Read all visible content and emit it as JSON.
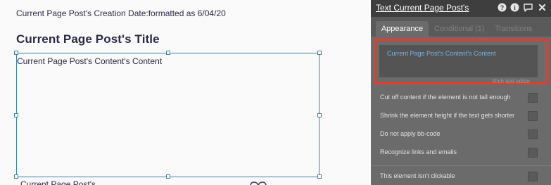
{
  "canvas": {
    "creation_date_text": "Current Page Post's Creation Date:formatted as 6/04/20",
    "post_title": "Current Page Post's Title",
    "content_text": "Current Page Post's Content's Content",
    "bottom_text": "Current Page Post's"
  },
  "panel": {
    "title": "Text Current Page Post's",
    "header_icons": [
      "help-icon",
      "info-icon",
      "comment-icon",
      "close-icon"
    ],
    "tabs": [
      {
        "label": "Appearance",
        "active": true
      },
      {
        "label": "Conditional (1)",
        "active": false
      },
      {
        "label": "Transitions",
        "active": false
      }
    ],
    "content_field_value": "Current Page Post's Content's Content",
    "rich_text_label": "Rich text editor",
    "options": [
      {
        "label": "Cut off content if the element is not tall enough",
        "checked": false
      },
      {
        "label": "Shrink the element height if the text gets shorter",
        "checked": false
      },
      {
        "label": "Do not apply bb-code",
        "checked": false
      },
      {
        "label": "Recognize links and emails",
        "checked": false
      },
      {
        "label": "This element isn't clickable",
        "checked": false
      }
    ]
  },
  "colors": {
    "highlight": "#e83b2a",
    "selection": "#3f7fa8",
    "field_text": "#7ab2de",
    "panel_bg": "#6b6b6b"
  }
}
